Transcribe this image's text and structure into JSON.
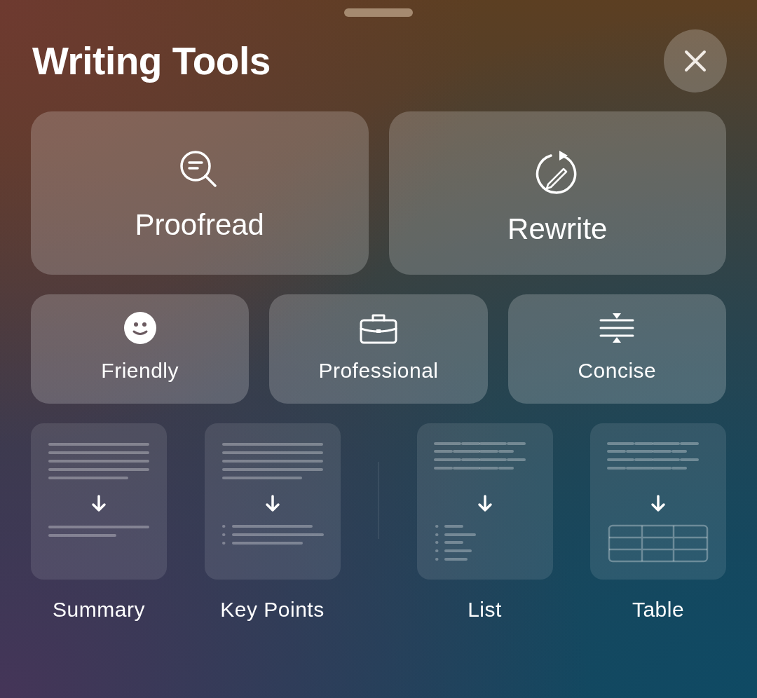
{
  "sheet": {
    "title": "Writing Tools"
  },
  "primary_actions": [
    {
      "label": "Proofread"
    },
    {
      "label": "Rewrite"
    }
  ],
  "tone_actions": [
    {
      "label": "Friendly"
    },
    {
      "label": "Professional"
    },
    {
      "label": "Concise"
    }
  ],
  "format_actions": [
    {
      "label": "Summary"
    },
    {
      "label": "Key Points"
    },
    {
      "label": "List"
    },
    {
      "label": "Table"
    }
  ]
}
